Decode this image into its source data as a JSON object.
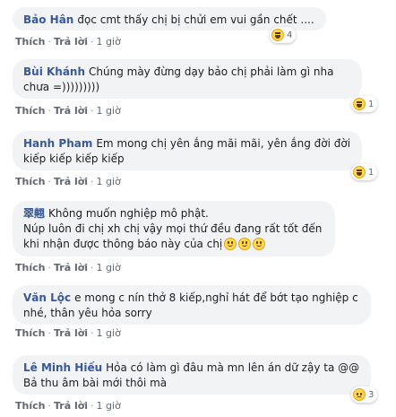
{
  "comments": [
    {
      "author": "Bảo Hân",
      "text": "đọc cmt thấy chị bị chửi em vui gần chết ....",
      "like": "Thích",
      "reply": "Trả lời",
      "time": "1 giờ",
      "reaction": {
        "icon": "haha-icon",
        "count": "4"
      }
    },
    {
      "author": "Bùi Khánh",
      "text": "Chúng mày đừng dạy bảo chị phải làm gì nha chưa =)))))))))",
      "like": "Thích",
      "reply": "Trả lời",
      "time": "1 giờ",
      "reaction": {
        "icon": "haha-icon",
        "count": "1"
      }
    },
    {
      "author": "Hanh Pham",
      "text": "Em mong chị yên ắng mãi mãi, yên ắng đời đời kiếp kiếp kiếp kiếp",
      "like": "Thích",
      "reply": "Trả lời",
      "time": "1 giờ",
      "reaction": {
        "icon": "haha-icon",
        "count": "1"
      }
    },
    {
      "author": "翠翹",
      "text": "Không muốn nghiệp mô phật.",
      "text_line2": "Núp luôn đi chị xh chị vậy mọi thứ đều đang rất tốt đến khi nhận được thông báo này của chị",
      "emoji_icon": "smile-icon",
      "like": "Thích",
      "reply": "Trả lời",
      "time": "1 giờ"
    },
    {
      "author": "Văn Lộc",
      "text": "e mong c nín thở 8 kiếp,nghỉ hát để bớt tạo nghiệp c nhé, thân yêu hỏa sorry",
      "like": "Thích",
      "reply": "Trả lời",
      "time": "1 giờ"
    },
    {
      "author": "Lê Minh Hiếu",
      "text": "Hỏa có làm gì đâu mà mn lên án dữ zậy ta @@ Bả thu âm bài mới thôi mà",
      "like": "Thích",
      "reply": "Trả lời",
      "time": "1 giờ",
      "reaction": {
        "icon": "sad-icon",
        "count": "3"
      }
    }
  ],
  "colors": {
    "author": "#385898",
    "bubble": "#f2f3f5",
    "meta": "#606770"
  }
}
